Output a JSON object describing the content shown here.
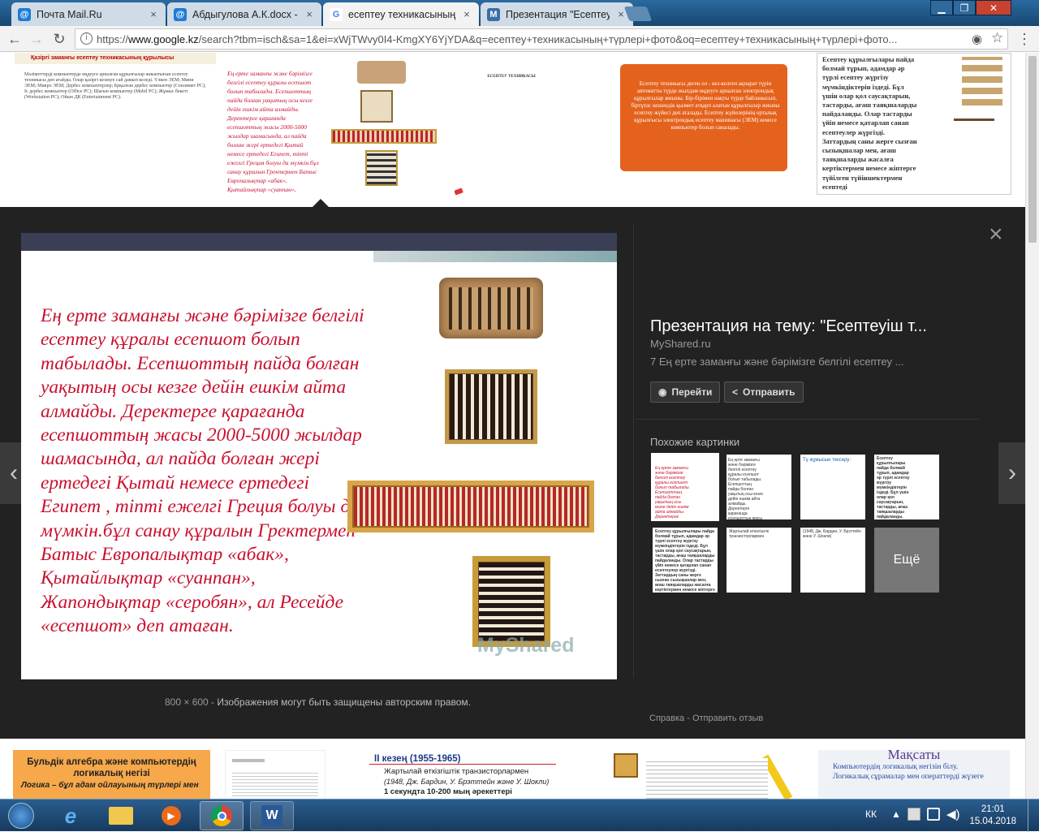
{
  "tabs": [
    {
      "title": "Почта Mail.Ru",
      "icon": "@",
      "icon_color": "#1e7bd6"
    },
    {
      "title": "Абдыгулова А.К.docx - Р",
      "icon": "@",
      "icon_color": "#1e7bd6"
    },
    {
      "title": "есептеу техникасының т",
      "icon": "G",
      "icon_color": "#4285f4"
    },
    {
      "title": "Презентация \"Есептеу т",
      "icon": "M",
      "icon_color": "#3a6ea5"
    }
  ],
  "toolbar": {
    "url_scheme": "https://",
    "url_host": "www.google.kz",
    "url_rest": "/search?tbm=isch&sa=1&ei=xWjTWvy0I4-KmgXY6YjYDA&q=есептеу+техникасының+түрлері+фото&oq=есептеу+техникасының+түрлері+фото..."
  },
  "top_thumbs": {
    "t1_title": "Қазіргі заманғы есептеу техникасының құрылысы",
    "t1_body": "Мәліметтерді компьютерде өңдеуге арналған құрылғылар жиынтығын есептеу техникасы деп атайды. Олар қазіргі кезеңге сай дамып келеді. Үлкен ЭЕМ; Мини ЭЕМ; Микро ЭЕМ; Дербес компьютерлер; Брқалған дербес компьютер (Сонлимет PC); Іс дербес компьютер (Office PC); Шағын компьютер (Mobil PC); Жұмыс бекеті (Workstation PC); Ойын ДК (Entertainment PC).",
    "t2_text": "Ең ерте заманғы және бәрімізге белгілі есептеу құралы есепшот болып табылады. Есепшоттың пайда болған уақытың осы кезге дейін ешкім айта алмайды. Деректерге қарағанда есепшоттың жасы 2000-5000 жылдар шамасында, ал пайда болған жері ертедегі Қытай немесе ертедегі Египет, тіпті ежелгі Греция болуы да мүмкін.бұл санау құралын Гректермен Батыс Европалықтар «абак», Қытайлықтар «суанпан», Жапондықтар «серобян», ал Ресейде «есепшот» деп атаған.",
    "t3_title": "ЕСЕПТЕУ ТЕХНИКАСЫ",
    "t4_text": "Есептеу техникасы деген ол - кез-келген ақпарат түрін автоматты түрде жылдам өңдеуге арналған электрондық құрылғылар жиыны. Бір-бірімен нақты түрде байланысып, біртұтас кешендік қызмет атқарп алатын құрылғылар жиыны есептеу жүйесі деп аталады. Есептеу жүйелерінің орталық құрылғысы электрондық есептеу машинасы (ЭЕМ) немесе компьютер болып саналады.",
    "t5_text": "Есептеу құрылғылары пайда болмай тұрып, адамдар әр түрлі есептеу жүргізу мүмкіндіктерін іздеді. Бұл үшін олар қол саусақтарын, тастарды, ағаш таяқшаларды пайдаланды. Олар тастарды үйіп немесе қатарлап санап есептеулер жүргізді. Заттардың саны жерге сызған сызықшалар мен, ағаш таяқшаларды жасалға кертіктермен немесе жіптерге түйілген түйіншектермен есептеді",
    "watermark": "MyShared"
  },
  "viewer": {
    "slide_text": "Ең ерте заманғы және бәрімізге белгілі есептеу құралы есепшот болып табылады. Есепшоттың пайда болған уақытың осы кезге дейін ешкім айта алмайды. Деректерге қарағанда есепшоттың жасы 2000-5000 жылдар шамасында, ал пайда болған жері ертедегі Қытай немесе ертедегі Египет , тіпті ежелгі Греция болуы да мүмкін.бұл санау құралын Гректермен Батыс Европалықтар «абак», Қытайлықтар «суанпан», Жапондықтар «серобян», ал Ресейде «есепшот» деп атаған.",
    "slide_logo": "MyShared",
    "title": "Презентация на тему: \"Есептеуіш т...",
    "site": "MyShared.ru",
    "desc": "7 Ең ерте заманғы және бәрімізге белгілі есептеу ...",
    "visit_label": "Перейти",
    "share_label": "Отправить",
    "similar_label": "Похожие картинки",
    "more_label": "Ещё",
    "sim_heading": "Тү жұмысын тексеру:",
    "dims": "800 × 600",
    "copyright": "Изображения могут быть защищены авторским правом.",
    "help": "Справка",
    "feedback": "Отправить отзыв",
    "close_icon": "×"
  },
  "bottom_thumbs": {
    "b1_title": "Бульдік алгебра және компьютердің логикалық негізі",
    "b1_sub": "Логика – бұл адам ойлауының түрлері мен",
    "b3_title": "II кезең (1955-1965)",
    "b3_l1": "Жартылай өткізгіштік транзисторлармен",
    "b3_l2": "(1948, Дж. Бардин, У. Брэттейн және У. Шокли)",
    "b3_l3": "1 секундта 10-200 мың  әрекеттері",
    "b5_title": "Мақсаты",
    "b5_l1": "Компьютердің логикалық негізін білу.",
    "b5_l2": "Логикалық сұрамалар мен операттерді жүзеге"
  },
  "taskbar": {
    "lang": "КК",
    "time": "21:01",
    "date": "15.04.2018"
  }
}
